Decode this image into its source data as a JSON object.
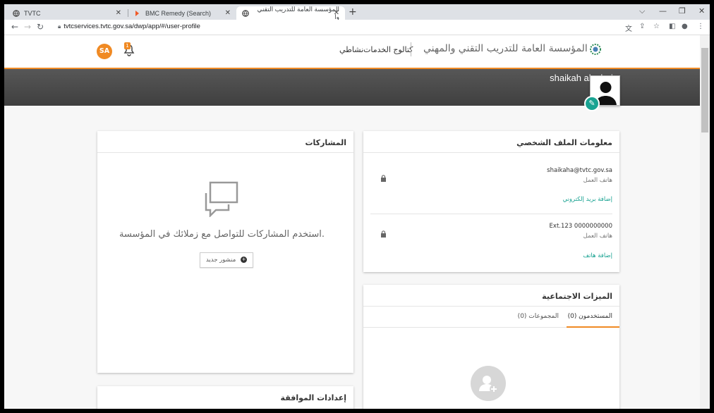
{
  "browser": {
    "tabs": [
      {
        "title": "TVTC"
      },
      {
        "title": "BMC Remedy (Search)"
      },
      {
        "title": "المؤسسة العامة للتدريب التقني وا"
      }
    ],
    "new_tab": "+",
    "url": "tvtcservices.tvtc.gov.sa/dwp/app/#/user-profile"
  },
  "header": {
    "org_name": "المؤسسة العامة للتدريب التقني والمهني",
    "nav_catalog": "كتالوج الخدمات",
    "nav_activity": "نشاطي",
    "user_initials": "SA",
    "notification_count": "1"
  },
  "profile": {
    "name": "shaikah alsubaie"
  },
  "posts_card": {
    "title": "المشاركات",
    "empty_text": "استخدم المشاركات للتواصل مع زملائك في المؤسسة.",
    "new_post_label": "منشور جديد"
  },
  "approval_card": {
    "title": "إعدادات الموافقة"
  },
  "profile_info_card": {
    "title": "معلومات الملف الشخصي",
    "email": "shaikaha@tvtc.gov.sa",
    "email_sub": "هاتف العمل",
    "add_email_link": "إضافة بريد إلكتروني",
    "phone": "Ext.123 0000000000",
    "phone_sub": "هاتف العمل",
    "add_phone_link": "إضافة هاتف"
  },
  "social_card": {
    "title": "الميزات الاجتماعية",
    "tab_users": "المستخدمون (0)",
    "tab_groups": "المجموعات (0)"
  },
  "colors": {
    "accent": "#f08a24",
    "teal": "#1aa392",
    "band": "#4a4a4a"
  }
}
